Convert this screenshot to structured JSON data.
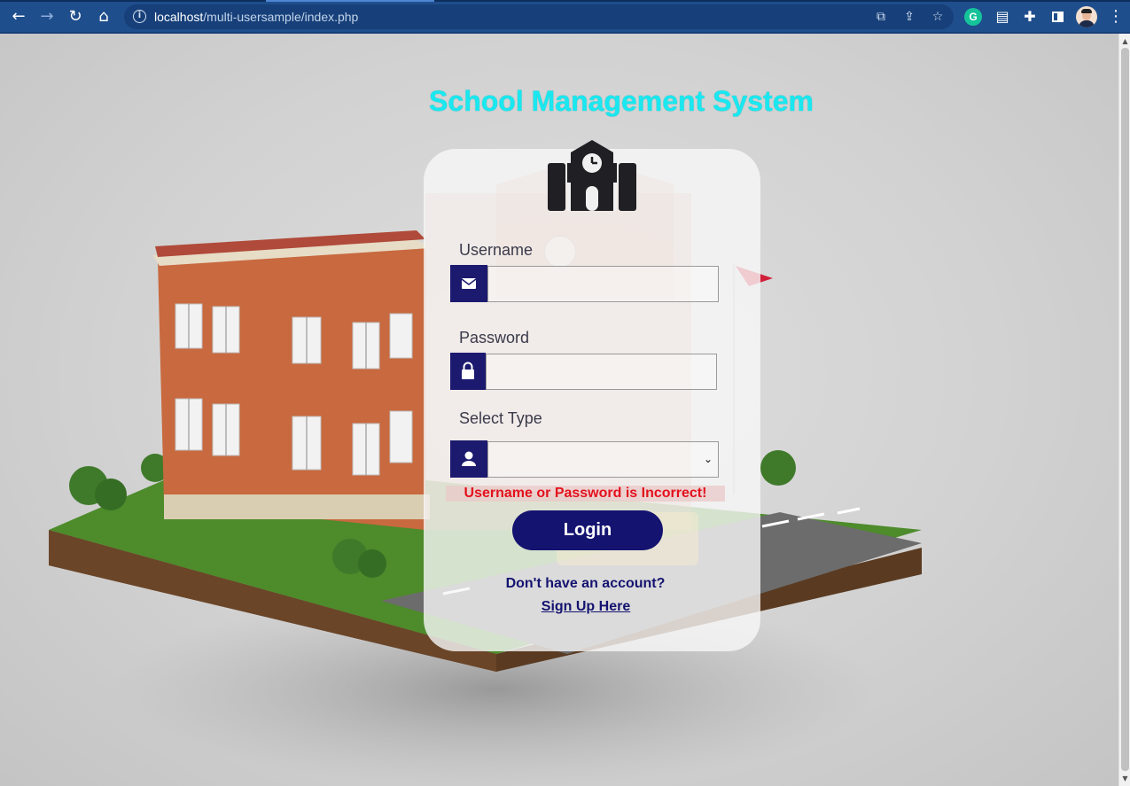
{
  "browser": {
    "url_host": "localhost",
    "url_path": "/multi-usersample/index.php",
    "back_icon": "arrow-left-icon",
    "forward_icon": "arrow-right-icon",
    "reload_icon": "reload-icon",
    "home_icon": "home-icon",
    "info_icon": "info-icon",
    "extensions": [
      "grammarly-icon",
      "save-icon",
      "puzzle-icon",
      "side-panel-icon"
    ]
  },
  "page": {
    "title": "School Management System",
    "title_color": "#19e8f0",
    "accent_color": "#141370",
    "logo_icon": "school-icon"
  },
  "form": {
    "username_label": "Username",
    "username_value": "",
    "username_icon": "envelope-icon",
    "password_label": "Password",
    "password_value": "",
    "password_icon": "lock-icon",
    "type_label": "Select Type",
    "type_value": "",
    "type_icon": "user-icon",
    "error": "Username or Password is Incorrect!",
    "error_color": "#e3111c",
    "login_label": "Login",
    "no_account_text": "Don't have an account?",
    "signup_link": "Sign Up Here"
  }
}
